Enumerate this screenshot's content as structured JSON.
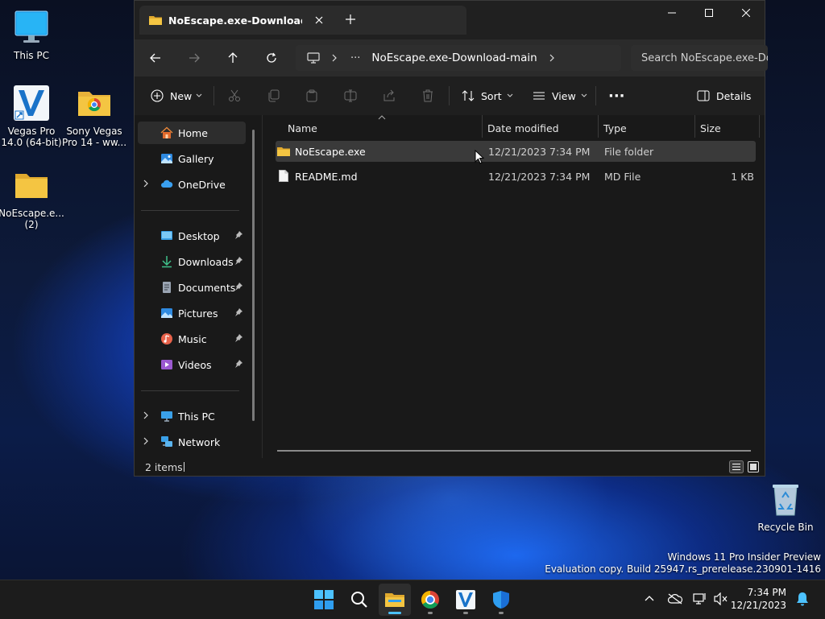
{
  "desktop": {
    "icons": [
      {
        "label": "This PC"
      },
      {
        "label": "Vegas Pro 14.0 (64-bit)"
      },
      {
        "label": "Sony Vegas Pro 14 - ww..."
      },
      {
        "label": "NoEscape.e... (2)"
      },
      {
        "label": "Recycle Bin"
      }
    ],
    "watermark_line1": "Windows 11 Pro Insider Preview",
    "watermark_line2": "Evaluation copy. Build 25947.rs_prerelease.230901-1416"
  },
  "explorer": {
    "tab_title": "NoEscape.exe-Download-main",
    "address": {
      "ellipsis": "···",
      "crumb": "NoEscape.exe-Download-main"
    },
    "search_placeholder": "Search NoEscape.exe-Download-main",
    "toolbar": {
      "new_label": "New",
      "sort_label": "Sort",
      "view_label": "View",
      "more_label": "···",
      "details_label": "Details"
    },
    "nav": {
      "home": "Home",
      "gallery": "Gallery",
      "onedrive": "OneDrive",
      "quick": [
        {
          "label": "Desktop"
        },
        {
          "label": "Downloads"
        },
        {
          "label": "Documents"
        },
        {
          "label": "Pictures"
        },
        {
          "label": "Music"
        },
        {
          "label": "Videos"
        }
      ],
      "thispc": "This PC",
      "network": "Network"
    },
    "columns": {
      "name": "Name",
      "date": "Date modified",
      "type": "Type",
      "size": "Size"
    },
    "files": [
      {
        "name": "NoEscape.exe",
        "date": "12/21/2023 7:34 PM",
        "type": "File folder",
        "size": ""
      },
      {
        "name": "README.md",
        "date": "12/21/2023 7:34 PM",
        "type": "MD File",
        "size": "1 KB"
      }
    ],
    "status": "2 items"
  },
  "taskbar": {
    "time": "7:34 PM",
    "date": "12/21/2023"
  },
  "colors": {
    "accent": "#4cc2ff",
    "folder": "#f4c542",
    "window_bg": "#191919"
  }
}
